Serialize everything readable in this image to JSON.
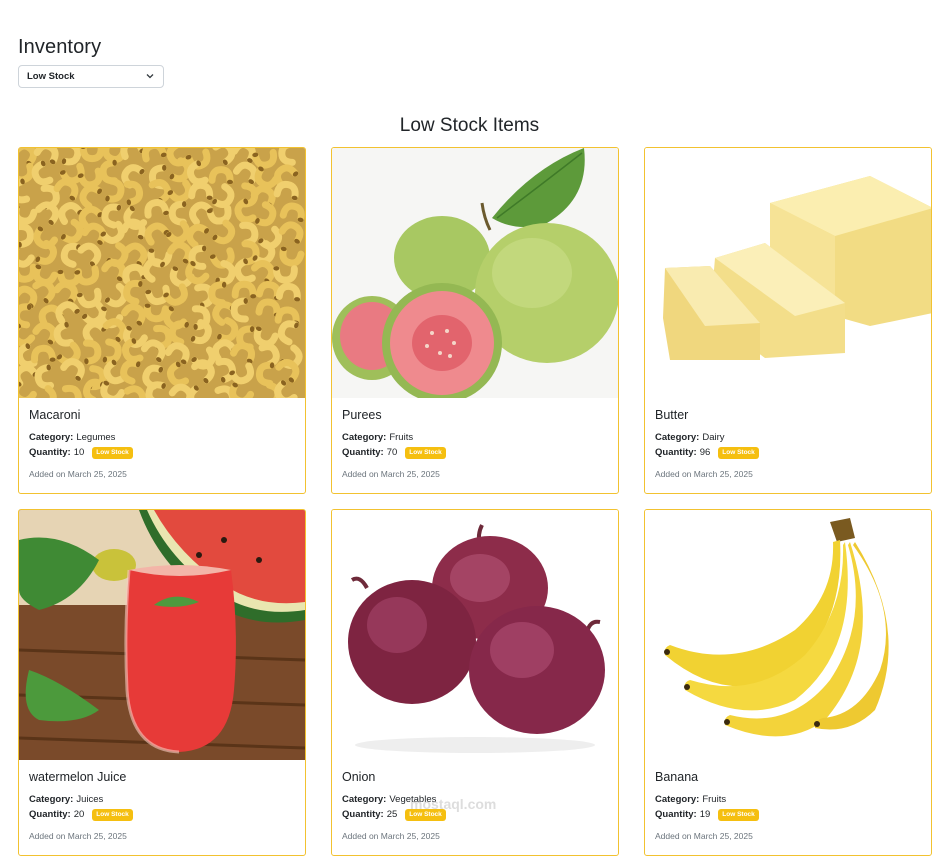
{
  "header": {
    "title": "Inventory",
    "filter": {
      "selected": "Low Stock",
      "icon": "chevron-down-icon"
    }
  },
  "section": {
    "title": "Low Stock Items"
  },
  "labels": {
    "category": "Category:",
    "quantity": "Quantity:"
  },
  "colors": {
    "accent": "#f5bf10",
    "card_border": "#f2c230"
  },
  "items": [
    {
      "name": "Macaroni",
      "category": "Legumes",
      "quantity": "10",
      "badge": "Low Stock",
      "added": "Added on March 25, 2025",
      "image": "macaroni-image"
    },
    {
      "name": "Purees",
      "category": "Fruits",
      "quantity": "70",
      "badge": "Low Stock",
      "added": "Added on March 25, 2025",
      "image": "guava-image"
    },
    {
      "name": "Butter",
      "category": "Dairy",
      "quantity": "96",
      "badge": "Low Stock",
      "added": "Added on March 25, 2025",
      "image": "butter-image"
    },
    {
      "name": "watermelon Juice",
      "category": "Juices",
      "quantity": "20",
      "badge": "Low Stock",
      "added": "Added on March 25, 2025",
      "image": "watermelon-juice-image"
    },
    {
      "name": "Onion",
      "category": "Vegetables",
      "quantity": "25",
      "badge": "Low Stock",
      "added": "Added on March 25, 2025",
      "image": "onion-image"
    },
    {
      "name": "Banana",
      "category": "Fruits",
      "quantity": "19",
      "badge": "Low Stock",
      "added": "Added on March 25, 2025",
      "image": "banana-image"
    }
  ],
  "watermark": "mostaql.com"
}
